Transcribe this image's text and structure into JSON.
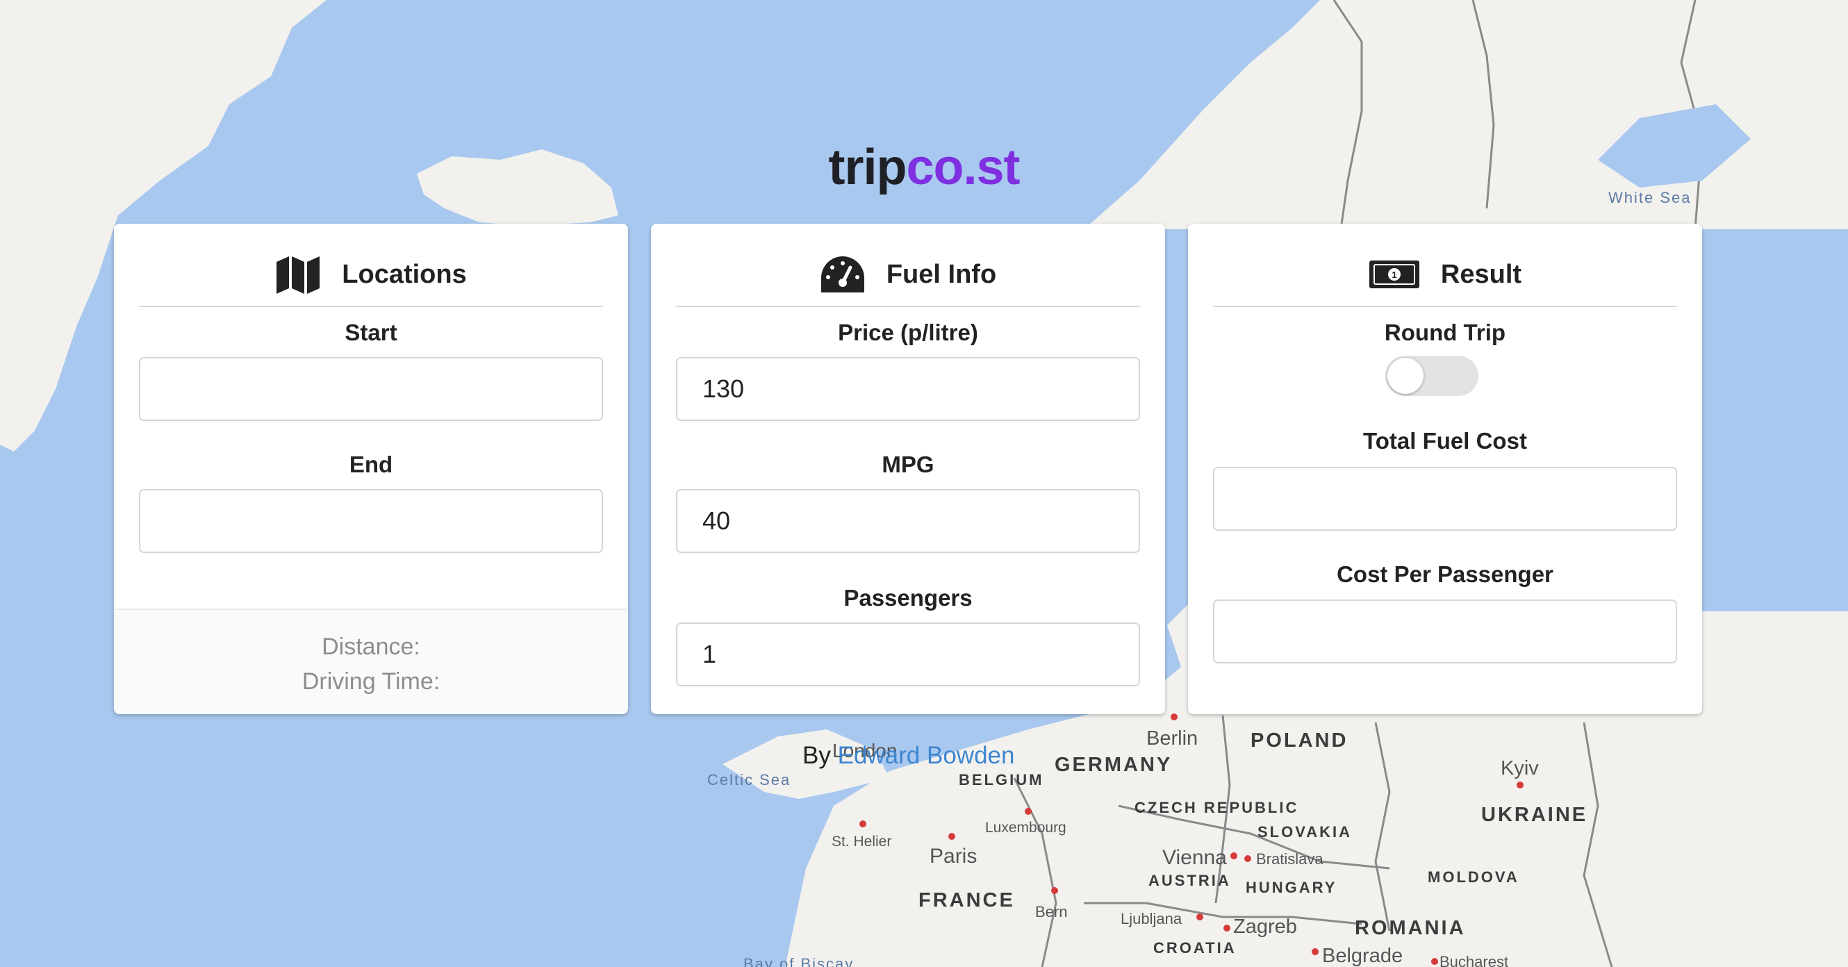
{
  "app": {
    "logo_part1": "trip",
    "logo_part2": "co.st"
  },
  "locations": {
    "title": "Locations",
    "icon": "map-icon",
    "start_label": "Start",
    "start_value": "",
    "end_label": "End",
    "end_value": "",
    "distance_label": "Distance:",
    "driving_time_label": "Driving Time:"
  },
  "fuel": {
    "title": "Fuel Info",
    "icon": "speedometer-icon",
    "price_label": "Price (p/litre)",
    "price_value": "130",
    "mpg_label": "MPG",
    "mpg_value": "40",
    "passengers_label": "Passengers",
    "passengers_value": "1"
  },
  "result": {
    "title": "Result",
    "icon": "money-bill-icon",
    "round_trip_label": "Round Trip",
    "round_trip_on": false,
    "total_label": "Total Fuel Cost",
    "total_value": "",
    "per_passenger_label": "Cost Per Passenger",
    "per_passenger_value": ""
  },
  "footer": {
    "by_text": "By",
    "author": "Edward Bowden"
  },
  "map": {
    "colors": {
      "sea": "#a9c8ef",
      "land": "#f2f1ee",
      "border": "#8a8a8a"
    },
    "labels": {
      "white_sea": "White Sea",
      "celtic_sea": "Celtic Sea",
      "bay_of_biscay": "Bay of Biscay",
      "poland": "POLAND",
      "germany": "GERMANY",
      "belgium": "BELGIUM",
      "czech_republic": "CZECH REPUBLIC",
      "slovakia": "SLOVAKIA",
      "austria": "AUSTRIA",
      "hungary": "HUNGARY",
      "ukraine": "UKRAINE",
      "moldova": "MOLDOVA",
      "romania": "ROMANIA",
      "france": "FRANCE",
      "croatia": "CROATIA",
      "berlin": "Berlin",
      "kyiv": "Kyiv",
      "paris": "Paris",
      "luxembourg": "Luxembourg",
      "st_helier": "St. Helier",
      "vienna": "Vienna",
      "bratislava": "Bratislava",
      "bern": "Bern",
      "ljubljana": "Ljubljana",
      "zagreb": "Zagreb",
      "belgrade": "Belgrade",
      "bucharest": "Bucharest",
      "london": "London"
    }
  }
}
